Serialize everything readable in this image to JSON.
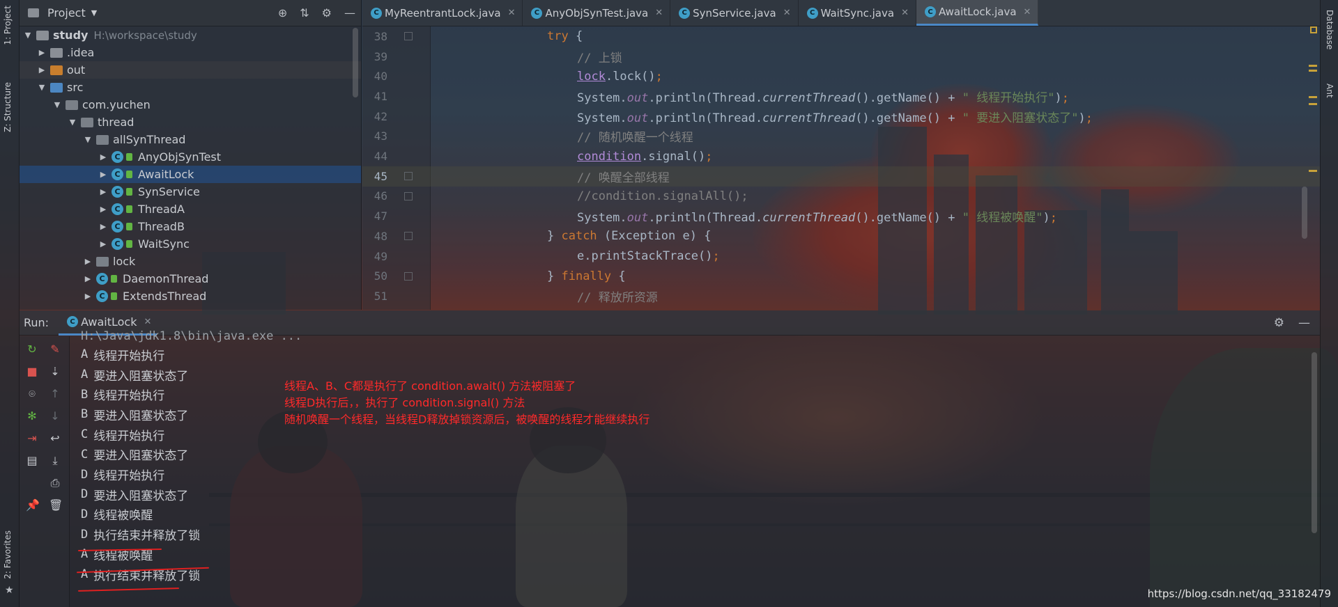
{
  "left_strip": {
    "project_tab": "1: Project",
    "structure_tab": "Z: Structure",
    "favorites_tab": "2: Favorites"
  },
  "right_strip": {
    "database_tab": "Database",
    "ant_tab": "Ant"
  },
  "project_panel": {
    "title": "Project",
    "tree": [
      {
        "label": "study",
        "path": "H:\\workspace\\study"
      },
      {
        "label": ".idea"
      },
      {
        "label": "out"
      },
      {
        "label": "src"
      },
      {
        "label": "com.yuchen"
      },
      {
        "label": "thread"
      },
      {
        "label": "allSynThread"
      },
      {
        "label": "AnyObjSynTest"
      },
      {
        "label": "AwaitLock"
      },
      {
        "label": "SynService"
      },
      {
        "label": "ThreadA"
      },
      {
        "label": "ThreadB"
      },
      {
        "label": "WaitSync"
      },
      {
        "label": "lock"
      },
      {
        "label": "DaemonThread"
      },
      {
        "label": "ExtendsThread"
      }
    ]
  },
  "editor": {
    "tabs": [
      {
        "label": "MyReentrantLock.java"
      },
      {
        "label": "AnyObjSynTest.java"
      },
      {
        "label": "SynService.java"
      },
      {
        "label": "WaitSync.java"
      },
      {
        "label": "AwaitLock.java",
        "active": true
      }
    ],
    "line_numbers": [
      "38",
      "39",
      "40",
      "41",
      "42",
      "43",
      "44",
      "45",
      "46",
      "47",
      "48",
      "49",
      "50",
      "51"
    ],
    "current_line": "45"
  },
  "run_panel": {
    "label": "Run:",
    "tab": "AwaitLock",
    "command": "H:\\Java\\jdk1.8\\bin\\java.exe ...",
    "output": [
      {
        "thread": "A",
        "text": "线程开始执行"
      },
      {
        "thread": "A",
        "text": "要进入阻塞状态了"
      },
      {
        "thread": "B",
        "text": "线程开始执行"
      },
      {
        "thread": "B",
        "text": "要进入阻塞状态了"
      },
      {
        "thread": "C",
        "text": "线程开始执行"
      },
      {
        "thread": "C",
        "text": "要进入阻塞状态了"
      },
      {
        "thread": "D",
        "text": "线程开始执行"
      },
      {
        "thread": "D",
        "text": "要进入阻塞状态了"
      },
      {
        "thread": "D",
        "text": "线程被唤醒"
      },
      {
        "thread": "D",
        "text": "执行结束并释放了锁"
      },
      {
        "thread": "A",
        "text": "线程被唤醒"
      },
      {
        "thread": "A",
        "text": "执行结束并释放了锁"
      }
    ]
  },
  "annotation": {
    "line1": "线程A、B、C都是执行了 condition.await() 方法被阻塞了",
    "line2": "线程D执行后，，执行了 condition.signal() 方法",
    "line3": "随机唤醒一个线程，当线程D释放掉锁资源后，被唤醒的线程才能继续执行"
  },
  "watermark": "https://blog.csdn.net/qq_33182479",
  "colors": {
    "keyword": "#cc7832",
    "comment": "#808080",
    "string": "#6a8759",
    "field": "#9876aa",
    "annotation": "#ff2a2a",
    "selection": "#264876"
  }
}
